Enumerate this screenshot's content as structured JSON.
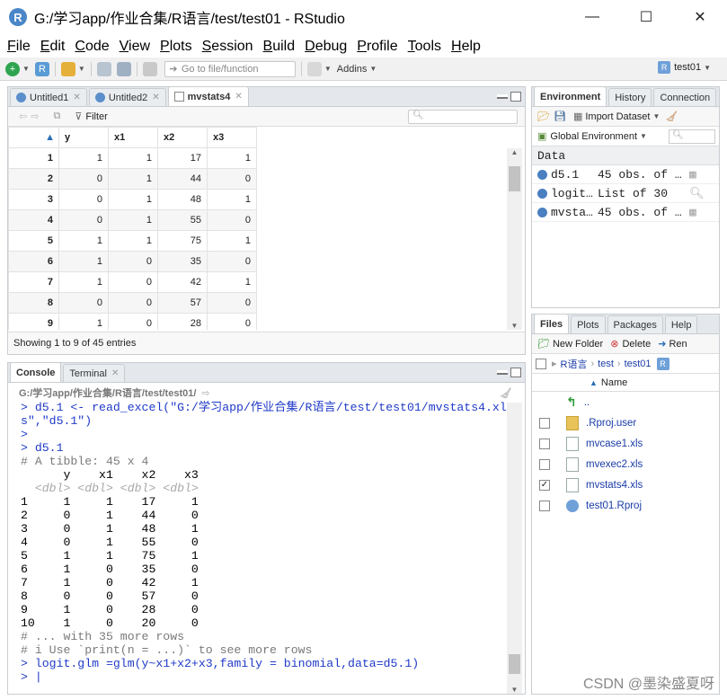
{
  "window": {
    "title": "G:/学习app/作业合集/R语言/test/test01 - RStudio",
    "min": "—",
    "max": "☐",
    "close": "✕"
  },
  "menu": [
    "File",
    "Edit",
    "Code",
    "View",
    "Plots",
    "Session",
    "Build",
    "Debug",
    "Profile",
    "Tools",
    "Help"
  ],
  "toolbar": {
    "goto_placeholder": "Go to file/function",
    "addins": "Addins",
    "project": "test01"
  },
  "source": {
    "tabs": [
      "Untitled1",
      "Untitled2",
      "mvstats4"
    ],
    "filter": "Filter",
    "columns": [
      "",
      "y",
      "x1",
      "x2",
      "x3"
    ],
    "rows": [
      [
        "1",
        "1",
        "1",
        "17",
        "1"
      ],
      [
        "2",
        "0",
        "1",
        "44",
        "0"
      ],
      [
        "3",
        "0",
        "1",
        "48",
        "1"
      ],
      [
        "4",
        "0",
        "1",
        "55",
        "0"
      ],
      [
        "5",
        "1",
        "1",
        "75",
        "1"
      ],
      [
        "6",
        "1",
        "0",
        "35",
        "0"
      ],
      [
        "7",
        "1",
        "0",
        "42",
        "1"
      ],
      [
        "8",
        "0",
        "0",
        "57",
        "0"
      ],
      [
        "9",
        "1",
        "0",
        "28",
        "0"
      ]
    ],
    "status": "Showing 1 to 9 of 45 entries"
  },
  "console": {
    "tabs": [
      "Console",
      "Terminal"
    ],
    "path": "G:/学习app/作业合集/R语言/test/test01/",
    "lines": [
      {
        "t": "> d5.1 <- read_excel(\"G:/学习app/作业合集/R语言/test/test01/mvstats4.xl",
        "c": "c-blue"
      },
      {
        "t": "s\",\"d5.1\")",
        "c": "c-blue"
      },
      {
        "t": ">",
        "c": "c-blue"
      },
      {
        "t": "> d5.1",
        "c": "c-blue"
      },
      {
        "t": "# A tibble: 45 x 4",
        "c": "c-gray"
      },
      {
        "t": "      y    x1    x2    x3",
        "c": "c-black"
      },
      {
        "t": "  <dbl> <dbl> <dbl> <dbl>",
        "c": "c-dim"
      },
      {
        "t": "1     1     1    17     1",
        "c": "c-black"
      },
      {
        "t": "2     0     1    44     0",
        "c": "c-black"
      },
      {
        "t": "3     0     1    48     1",
        "c": "c-black"
      },
      {
        "t": "4     0     1    55     0",
        "c": "c-black"
      },
      {
        "t": "5     1     1    75     1",
        "c": "c-black"
      },
      {
        "t": "6     1     0    35     0",
        "c": "c-black"
      },
      {
        "t": "7     1     0    42     1",
        "c": "c-black"
      },
      {
        "t": "8     0     0    57     0",
        "c": "c-black"
      },
      {
        "t": "9     1     0    28     0",
        "c": "c-black"
      },
      {
        "t": "10    1     0    20     0",
        "c": "c-black"
      },
      {
        "t": "# ... with 35 more rows",
        "c": "c-gray"
      },
      {
        "t": "# i Use `print(n = ...)` to see more rows",
        "c": "c-gray"
      },
      {
        "t": "> logit.glm =glm(y~x1+x2+x3,family = binomial,data=d5.1)",
        "c": "c-blue"
      },
      {
        "t": "> |",
        "c": "c-blue"
      }
    ]
  },
  "environment": {
    "tabs": [
      "Environment",
      "History",
      "Connection"
    ],
    "import_label": "Import Dataset",
    "scope": "Global Environment",
    "section": "Data",
    "rows": [
      {
        "name": "d5.1",
        "value": "45 obs. of …"
      },
      {
        "name": "logit…",
        "value": "List of 30"
      },
      {
        "name": "mvsta…",
        "value": "45 obs. of …"
      }
    ]
  },
  "files": {
    "tabs": [
      "Files",
      "Plots",
      "Packages",
      "Help"
    ],
    "new_folder": "New Folder",
    "delete": "Delete",
    "rename": "Ren",
    "crumbs": [
      "R语言",
      "test",
      "test01"
    ],
    "name_header": "Name",
    "up": "..",
    "items": [
      {
        "name": ".Rproj.user",
        "checked": false
      },
      {
        "name": "mvcase1.xls",
        "checked": false
      },
      {
        "name": "mvexec2.xls",
        "checked": false
      },
      {
        "name": "mvstats4.xls",
        "checked": true
      },
      {
        "name": "test01.Rproj",
        "checked": false
      }
    ]
  },
  "watermark": "CSDN @墨染盛夏呀"
}
